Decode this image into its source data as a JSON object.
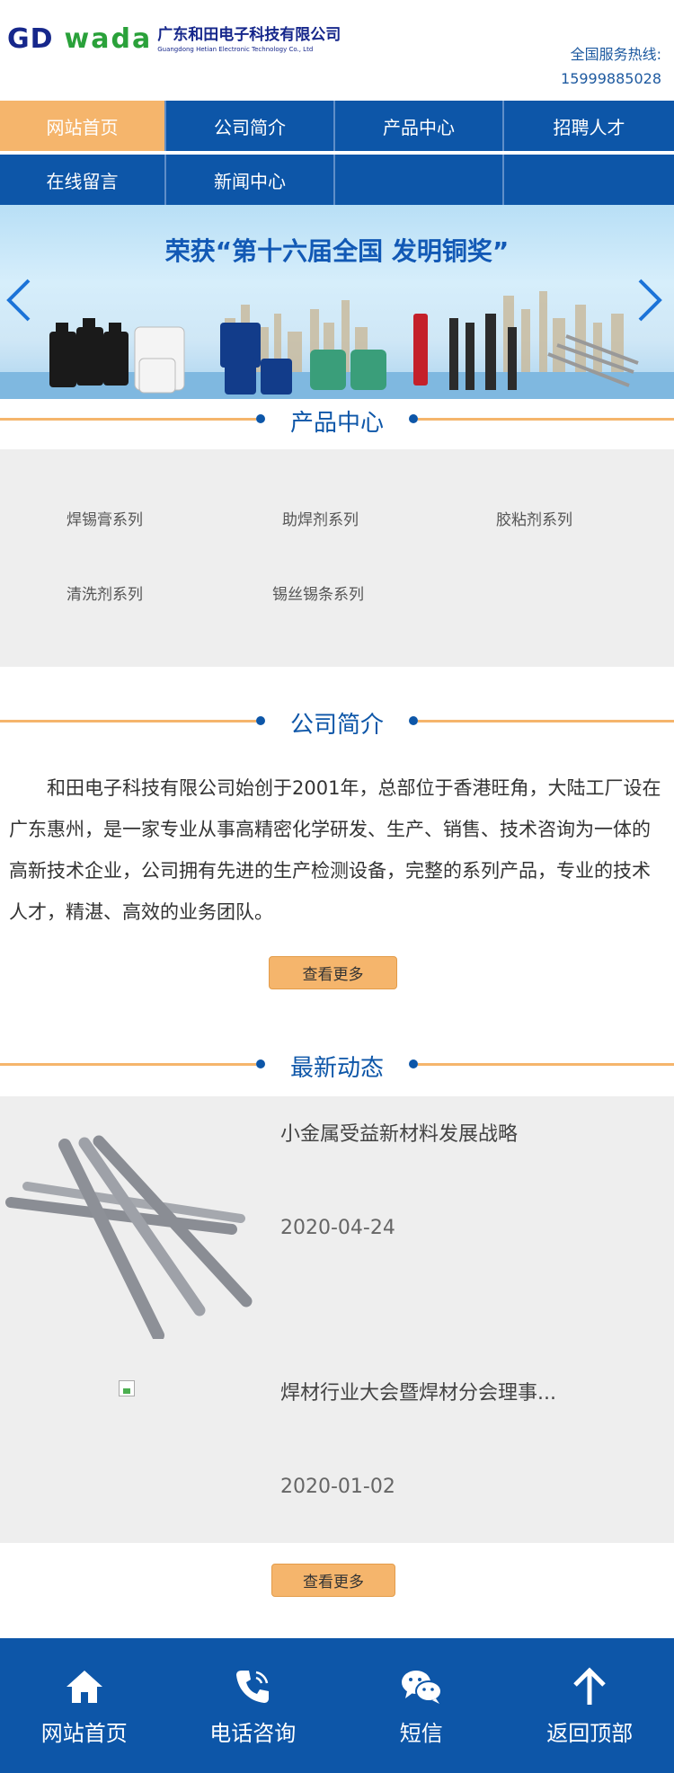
{
  "header": {
    "logo_gd": "GD",
    "logo_wada": "wada",
    "logo_cn": "广东和田电子科技有限公司",
    "logo_en": "Guangdong Hetian Electronic Technology Co., Ltd",
    "hotline_label": "全国服务热线:",
    "hotline_number": "15999885028"
  },
  "nav": {
    "items": [
      {
        "label": "网站首页",
        "active": true
      },
      {
        "label": "公司简介"
      },
      {
        "label": "产品中心"
      },
      {
        "label": "招聘人才"
      },
      {
        "label": "在线留言"
      },
      {
        "label": "新闻中心"
      },
      {
        "label": ""
      },
      {
        "label": ""
      }
    ]
  },
  "banner": {
    "title": "荣获“第十六届全国 发明铜奖”",
    "prev_icon": "chevron-left-icon",
    "next_icon": "chevron-right-icon"
  },
  "products": {
    "heading": "产品中心",
    "items": [
      "焊锡膏系列",
      "助焊剂系列",
      "胶粘剂系列",
      "清洗剂系列",
      "锡丝锡条系列"
    ]
  },
  "about": {
    "heading": "公司简介",
    "text": "和田电子科技有限公司始创于2001年，总部位于香港旺角，大陆工厂设在广东惠州，是一家专业从事高精密化学研发、生产、销售、技术咨询为一体的高新技术企业，公司拥有先进的生产检测设备，完整的系列产品，专业的技术人才，精湛、高效的业务团队。",
    "more_label": "查看更多"
  },
  "news": {
    "heading": "最新动态",
    "items": [
      {
        "title": "小金属受益新材料发展战略",
        "date": "2020-04-24"
      },
      {
        "title": "焊材行业大会暨焊材分会理事...",
        "date": "2020-01-02"
      }
    ],
    "more_label": "查看更多"
  },
  "footer": {
    "items": [
      {
        "label": "网站首页",
        "icon": "home-icon"
      },
      {
        "label": "电话咨询",
        "icon": "phone-icon"
      },
      {
        "label": "短信",
        "icon": "wechat-icon"
      },
      {
        "label": "返回顶部",
        "icon": "arrow-up-icon"
      }
    ]
  },
  "colors": {
    "primary": "#0d56a8",
    "accent": "#f5b56c",
    "panel": "#eeeeee"
  }
}
